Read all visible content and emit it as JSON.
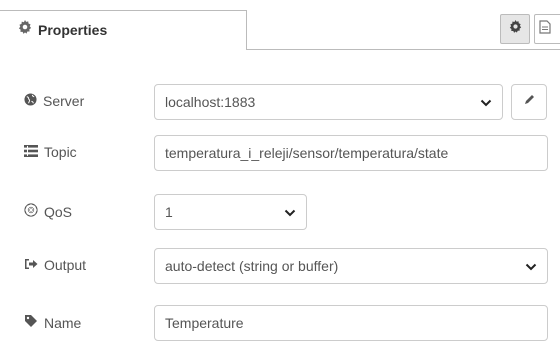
{
  "tab": {
    "label": "Properties",
    "icon": "gear-icon"
  },
  "toolbar": {
    "settings_icon": "gear-icon",
    "description_icon": "document-icon"
  },
  "fields": {
    "server": {
      "label": "Server",
      "icon": "globe-icon",
      "value": "localhost:1883",
      "edit_icon": "pencil-icon"
    },
    "topic": {
      "label": "Topic",
      "icon": "list-icon",
      "value": "temperatura_i_releji/sensor/temperatura/state"
    },
    "qos": {
      "label": "QoS",
      "icon": "qos-icon",
      "value": "1"
    },
    "output": {
      "label": "Output",
      "icon": "sign-out-icon",
      "value": "auto-detect (string or buffer)"
    },
    "name": {
      "label": "Name",
      "icon": "tag-icon",
      "value": "Temperature"
    }
  },
  "colors": {
    "border": "#cccccc",
    "text": "#555555",
    "tab_border": "#bbbbbb",
    "active_button": "#e6e6e6"
  }
}
